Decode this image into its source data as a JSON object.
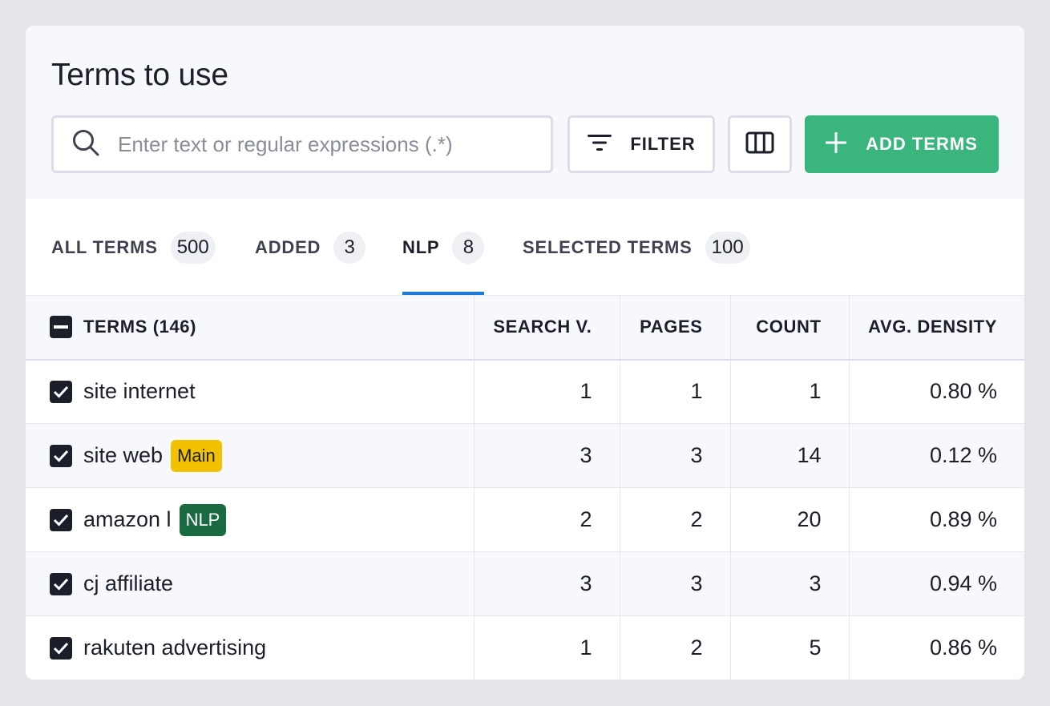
{
  "page": {
    "title": "Terms to use"
  },
  "toolbar": {
    "search_placeholder": "Enter text or regular expressions (.*)",
    "filter_label": "FILTER",
    "add_terms_label": "ADD TERMS"
  },
  "tabs": [
    {
      "label": "ALL TERMS",
      "count": "500",
      "active": false
    },
    {
      "label": "ADDED",
      "count": "3",
      "active": false
    },
    {
      "label": "NLP",
      "count": "8",
      "active": true
    },
    {
      "label": "SELECTED TERMS",
      "count": "100",
      "active": false
    }
  ],
  "table": {
    "columns": [
      "TERMS (146)",
      "SEARCH V.",
      "PAGES",
      "COUNT",
      "AVG. DENSITY"
    ],
    "rows": [
      {
        "term": "site internet",
        "tag": "",
        "search_v": "1",
        "pages": "1",
        "count": "1",
        "avg_density": "0.80 %",
        "checked": true
      },
      {
        "term": "site web",
        "tag": "Main",
        "search_v": "3",
        "pages": "3",
        "count": "14",
        "avg_density": "0.12 %",
        "checked": true
      },
      {
        "term": "amazon l",
        "tag": "NLP",
        "search_v": "2",
        "pages": "2",
        "count": "20",
        "avg_density": "0.89 %",
        "checked": true
      },
      {
        "term": "cj affiliate",
        "tag": "",
        "search_v": "3",
        "pages": "3",
        "count": "3",
        "avg_density": "0.94 %",
        "checked": true
      },
      {
        "term": "rakuten advertising",
        "tag": "",
        "search_v": "1",
        "pages": "2",
        "count": "5",
        "avg_density": "0.86 %",
        "checked": true
      }
    ]
  },
  "colors": {
    "accent_green": "#3bb57e",
    "tab_underline": "#1e7bd8",
    "tag_main": "#f2c200",
    "tag_nlp": "#1a6b42"
  }
}
